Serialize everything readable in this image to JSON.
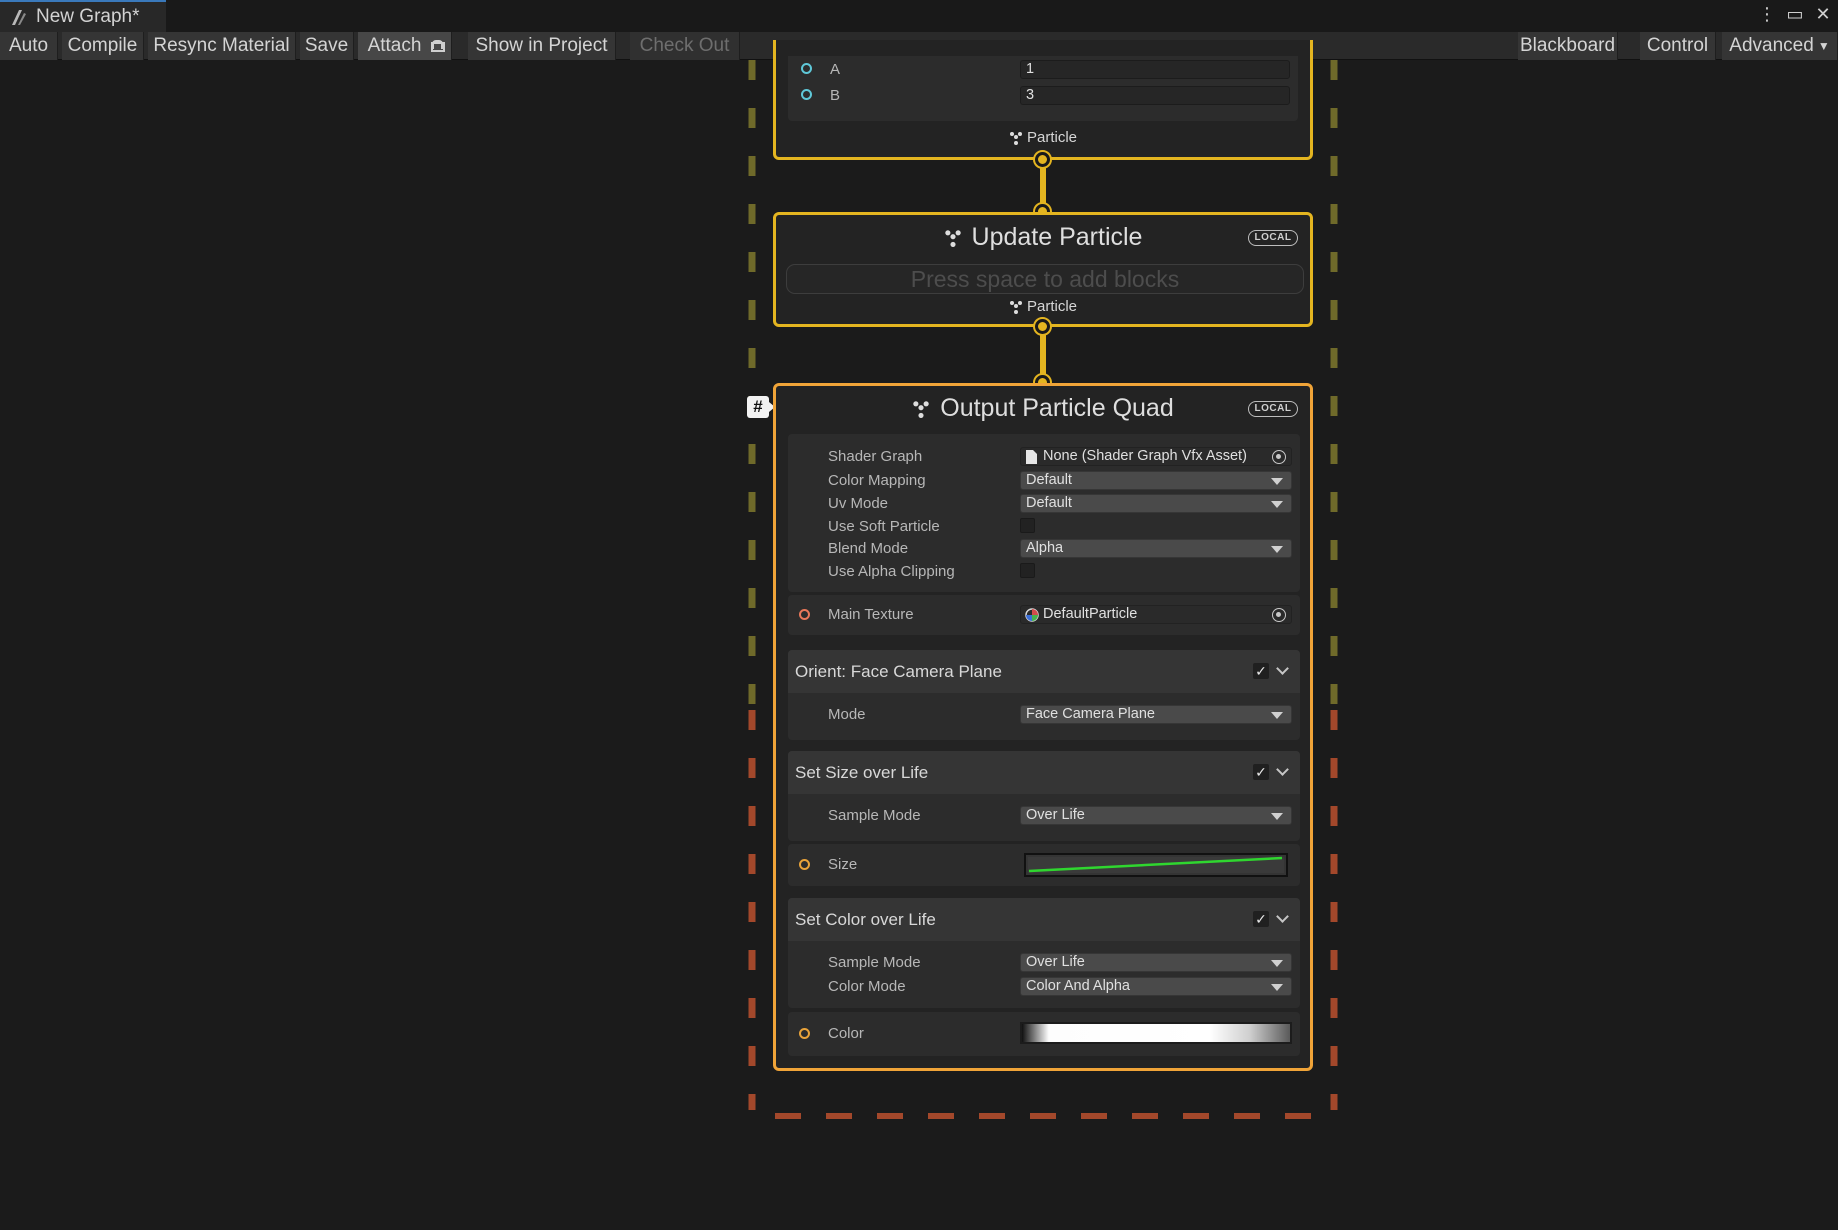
{
  "window": {
    "tab_title": "New Graph*"
  },
  "toolbar": {
    "auto": "Auto",
    "compile": "Compile",
    "resync_material": "Resync Material",
    "save": "Save",
    "attach": "Attach",
    "show_in_project": "Show in Project",
    "check_out": "Check Out",
    "blackboard": "Blackboard",
    "control": "Control",
    "advanced": "Advanced"
  },
  "initialize_tail": {
    "a_label": "A",
    "a_value": "1",
    "b_label": "B",
    "b_value": "3",
    "footer": "Particle"
  },
  "update_context": {
    "title": "Update Particle",
    "badge": "LOCAL",
    "add_blocks_hint": "Press space to add blocks",
    "footer": "Particle"
  },
  "output_context": {
    "title": "Output Particle Quad",
    "badge": "LOCAL",
    "settings": {
      "shader_graph_label": "Shader Graph",
      "shader_graph_value": "None (Shader Graph Vfx Asset)",
      "color_mapping_label": "Color Mapping",
      "color_mapping_value": "Default",
      "uv_mode_label": "Uv Mode",
      "uv_mode_value": "Default",
      "use_soft_particle_label": "Use Soft Particle",
      "blend_mode_label": "Blend Mode",
      "blend_mode_value": "Alpha",
      "use_alpha_clipping_label": "Use Alpha Clipping",
      "main_texture_label": "Main Texture",
      "main_texture_value": "DefaultParticle"
    },
    "blocks": {
      "orient": {
        "title": "Orient: Face Camera Plane",
        "mode_label": "Mode",
        "mode_value": "Face Camera Plane",
        "enabled": true
      },
      "size": {
        "title": "Set Size over Life",
        "sample_mode_label": "Sample Mode",
        "sample_mode_value": "Over Life",
        "size_label": "Size",
        "enabled": true,
        "curve_color": "#2fd62f"
      },
      "color": {
        "title": "Set Color over Life",
        "sample_mode_label": "Sample Mode",
        "sample_mode_value": "Over Life",
        "color_mode_label": "Color Mode",
        "color_mode_value": "Color And Alpha",
        "color_label": "Color",
        "enabled": true
      }
    }
  },
  "colors": {
    "flow": "#e4b520",
    "output_border": "#f0a438",
    "system_dash_top": "#6f6a2a",
    "system_dash_bottom": "#a3482b"
  }
}
